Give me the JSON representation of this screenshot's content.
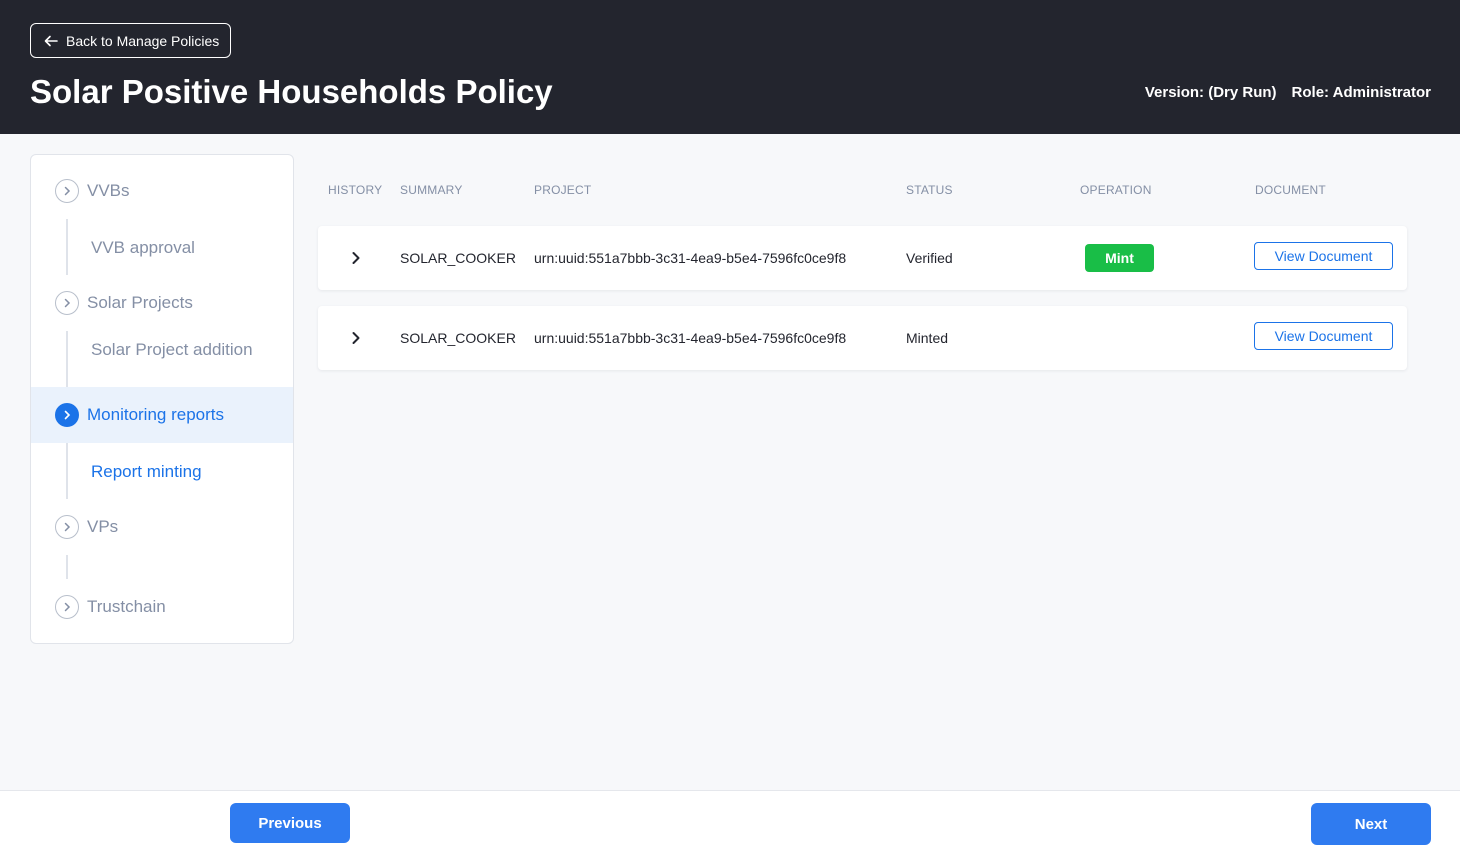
{
  "header": {
    "back_label": "Back to Manage Policies",
    "title": "Solar Positive Households Policy",
    "version": "Version: (Dry Run)",
    "role": "Role: Administrator"
  },
  "sidebar": {
    "items": [
      {
        "label": "VVBs",
        "sub": "VVB approval"
      },
      {
        "label": "Solar Projects",
        "sub": "Solar Project addition"
      },
      {
        "label": "Monitoring reports",
        "sub": "Report minting"
      },
      {
        "label": "VPs",
        "sub": ""
      },
      {
        "label": "Trustchain"
      }
    ]
  },
  "table": {
    "headers": [
      "HISTORY",
      "SUMMARY",
      "PROJECT",
      "STATUS",
      "OPERATION",
      "DOCUMENT"
    ],
    "rows": [
      {
        "summary": "SOLAR_COOKER",
        "project": "urn:uuid:551a7bbb-3c31-4ea9-b5e4-7596fc0ce9f8",
        "status": "Verified",
        "operation": "Mint",
        "document": "View Document"
      },
      {
        "summary": "SOLAR_COOKER",
        "project": "urn:uuid:551a7bbb-3c31-4ea9-b5e4-7596fc0ce9f8",
        "status": "Minted",
        "operation": "",
        "document": "View Document"
      }
    ]
  },
  "footer": {
    "previous": "Previous",
    "next": "Next"
  },
  "colors": {
    "header_bg": "#23252e",
    "accent": "#1b73e8",
    "mint": "#19be47"
  },
  "icons": {
    "back": "arrow-left-icon",
    "nav": "chevron-right-icon",
    "row_expand": "chevron-right-icon"
  }
}
